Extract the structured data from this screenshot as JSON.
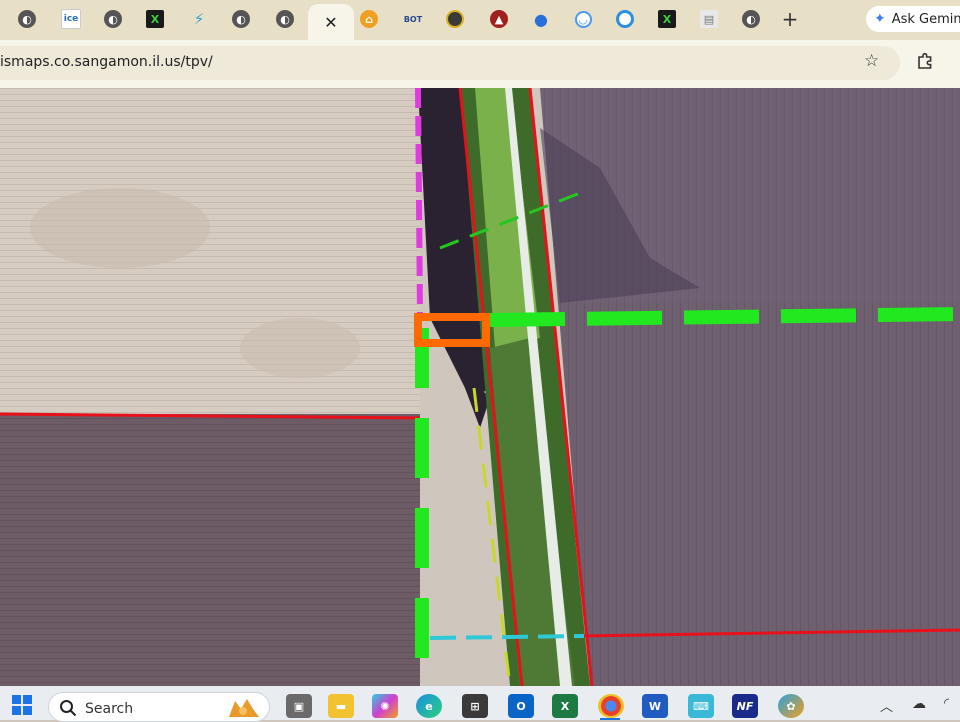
{
  "browser": {
    "tabs": [
      {
        "icon": "globe-icon",
        "active": false
      },
      {
        "icon": "ice-icon",
        "label": "ice",
        "active": false
      },
      {
        "icon": "globe-icon",
        "active": false
      },
      {
        "icon": "x-app-icon",
        "active": false
      },
      {
        "icon": "bolt-icon",
        "active": false
      },
      {
        "icon": "globe-icon",
        "active": false
      },
      {
        "icon": "globe-icon",
        "active": false
      },
      {
        "icon": "close-icon",
        "active": true
      },
      {
        "icon": "home-icon",
        "active": false
      },
      {
        "icon": "bot-icon",
        "label": "BOT",
        "active": false
      },
      {
        "icon": "circle-logo-icon",
        "active": false
      },
      {
        "icon": "circle-red-icon",
        "active": false
      },
      {
        "icon": "map-pin-icon",
        "active": false
      },
      {
        "icon": "smile-icon",
        "active": false
      },
      {
        "icon": "ring-icon",
        "active": false
      },
      {
        "icon": "x-app-icon",
        "active": false
      },
      {
        "icon": "doc-icon",
        "active": false
      },
      {
        "icon": "globe-icon",
        "active": false
      }
    ],
    "new_tab_label": "+",
    "gemini_label": "Ask Gemini",
    "url": "ismaps.co.sangamon.il.us/tpv/"
  },
  "taskbar": {
    "search_placeholder": "Search",
    "apps": [
      "file-explorer",
      "copilot",
      "edge",
      "store",
      "outlook",
      "excel",
      "chrome",
      "word",
      "keyboard",
      "nf-app",
      "settings"
    ],
    "excel_label": "X",
    "word_label": "W",
    "nf_label": "NF"
  },
  "colors": {
    "parcel_line": "#e8101a",
    "green_dash": "#22e81f",
    "magenta_dash": "#e03be0",
    "yellow_dash": "#c8d82a",
    "cyan_dash": "#2fc8d8",
    "highlight": "#ff6a00"
  }
}
